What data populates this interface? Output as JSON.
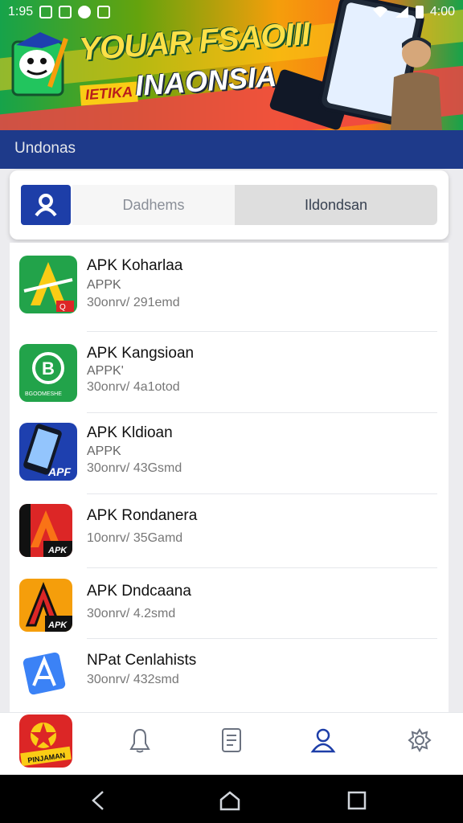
{
  "status_bar": {
    "time": "1:95",
    "battery": "4:00"
  },
  "banner": {
    "title": "YOUAR FSAOIII",
    "tag": "IETIKA",
    "subtitle": "INAONSIA"
  },
  "header": {
    "title": "Undonas"
  },
  "tabs": [
    {
      "label": "Dadhems",
      "active": false
    },
    {
      "label": "Ildondsan",
      "active": true
    }
  ],
  "apps": [
    {
      "title": "APK Koharlaa",
      "subtitle": "APPK",
      "meta": "30onrv/ 291emd",
      "icon": "green-a-icon",
      "icon_badge": "Q"
    },
    {
      "title": "APK Kangsioan",
      "subtitle": "APPK'",
      "meta": "30onrv/ 4a1otod",
      "icon": "green-b-icon",
      "icon_badge": "BGOOMESHE"
    },
    {
      "title": "APK Kldioan",
      "subtitle": "APPK",
      "meta": "30onrv/ 43Gsmd",
      "icon": "phone-apk-icon",
      "icon_badge": "APF"
    },
    {
      "title": "APK Rondanera",
      "subtitle": "",
      "meta": "10onrv/ 35Gamd",
      "icon": "red-a-icon",
      "icon_badge": "APK"
    },
    {
      "title": "APK Dndcaana",
      "subtitle": "",
      "meta": "30onrv/ 4.2smd",
      "icon": "yellow-a-icon",
      "icon_badge": "APK"
    },
    {
      "title": "NPat Cenlahists",
      "subtitle": "",
      "meta": "30onrv/ 432smd",
      "icon": "blue-store-icon",
      "icon_badge": ""
    }
  ],
  "bottom_nav": {
    "app_label": "PINJAMAN",
    "items": [
      "bell-icon",
      "document-icon",
      "person-icon",
      "settings-icon"
    ],
    "active": "person-icon"
  },
  "colors": {
    "primary": "#1d3ea8",
    "header": "#1e3a8a",
    "accent_green": "#22a34a",
    "accent_red": "#dc2626"
  }
}
